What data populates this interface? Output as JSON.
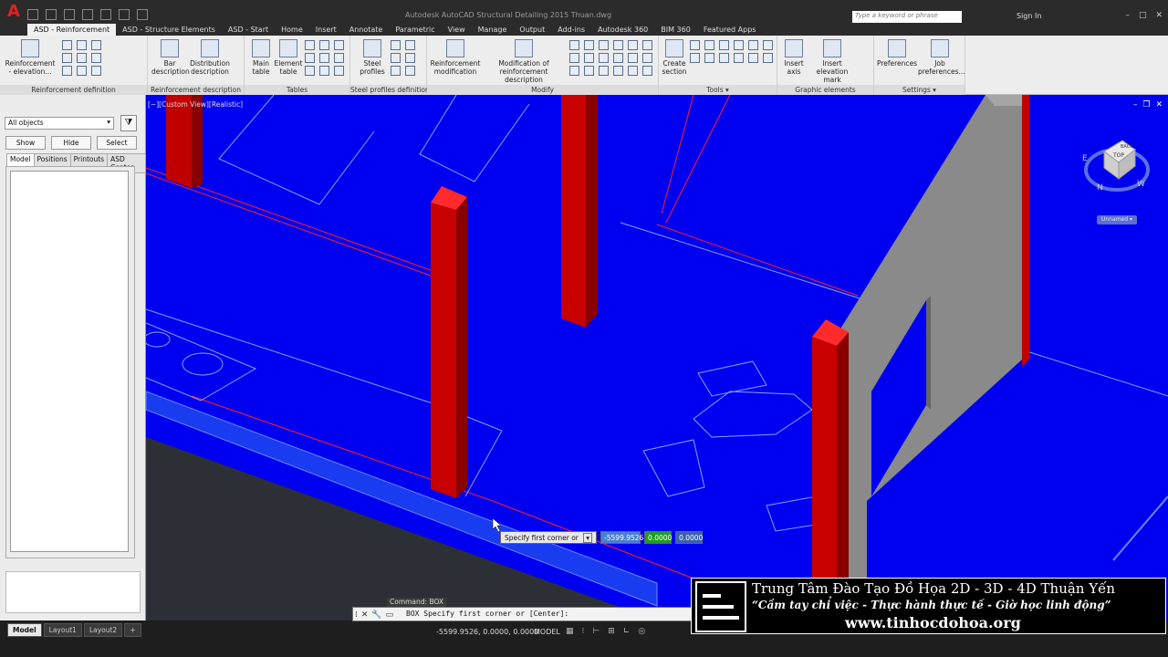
{
  "window": {
    "title": "Autodesk AutoCAD Structural Detailing 2015   Thuan.dwg",
    "search_placeholder": "Type a keyword or phrase",
    "sign_in": "Sign In"
  },
  "tabs": [
    "ASD - Reinforcement",
    "ASD - Structure Elements",
    "ASD - Start",
    "Home",
    "Insert",
    "Annotate",
    "Parametric",
    "View",
    "Manage",
    "Output",
    "Add-ins",
    "Autodesk 360",
    "BIM 360",
    "Featured Apps"
  ],
  "ribbon": {
    "panels": {
      "reinforcement_definition": "Reinforcement definition",
      "reinforcement_description": "Reinforcement description",
      "tables": "Tables",
      "steel_profiles_definition": "Steel profiles definition",
      "modify": "Modify",
      "tools": "Tools ▾",
      "graphic_elements": "Graphic elements",
      "settings": "Settings ▾"
    },
    "buttons": {
      "reinforcement_elevation": "Reinforcement - elevation...",
      "bar_description": "Bar description",
      "distribution_description": "Distribution description",
      "main_table": "Main table",
      "element_table": "Element table",
      "steel_profiles": "Steel profiles",
      "reinforcement_modification": "Reinforcement modification",
      "modification_of_reinforcement_description": "Modification of reinforcement description",
      "create_section": "Create section",
      "insert_axis": "Insert axis",
      "insert_elevation_mark": "Insert elevation mark",
      "preferences": "Preferences",
      "job_preferences": "Job preferences..."
    }
  },
  "left_panel": {
    "filter_value": "All objects",
    "show_label": "Show",
    "hide_label": "Hide",
    "select_label": "Select",
    "tabs": [
      "Model",
      "Positions",
      "Printouts",
      "ASD Center"
    ]
  },
  "viewport": {
    "label": "[−][Custom View][Realistic]",
    "viewcube_face": "TOP",
    "viewcube_side": "BACK",
    "compass_n": "N",
    "compass_w": "W",
    "compass_e": "E",
    "ucs_label": "Unnamed ▾",
    "bg_color": "#0000f0",
    "column_color": "#cc0000"
  },
  "prompt": {
    "label": "Specify first corner or",
    "x_value": "-5599.9526",
    "y_value": "0.0000",
    "z_value": "0.0000"
  },
  "command": {
    "history": "Command: BOX",
    "line": "BOX Specify first corner or [Center]:"
  },
  "status": {
    "layouts": [
      "Model",
      "Layout1",
      "Layout2"
    ],
    "coords": "-5599.9526, 0.0000, 0.0000",
    "mode": "MODEL"
  },
  "watermark": {
    "title": "Trung Tâm Đào Tạo Đồ Họa 2D - 3D - 4D Thuận Yến",
    "slogan": "“Cầm tay chỉ việc - Thực hành thực tế - Giờ học linh động”",
    "url": "www.tinhocdohoa.org"
  }
}
